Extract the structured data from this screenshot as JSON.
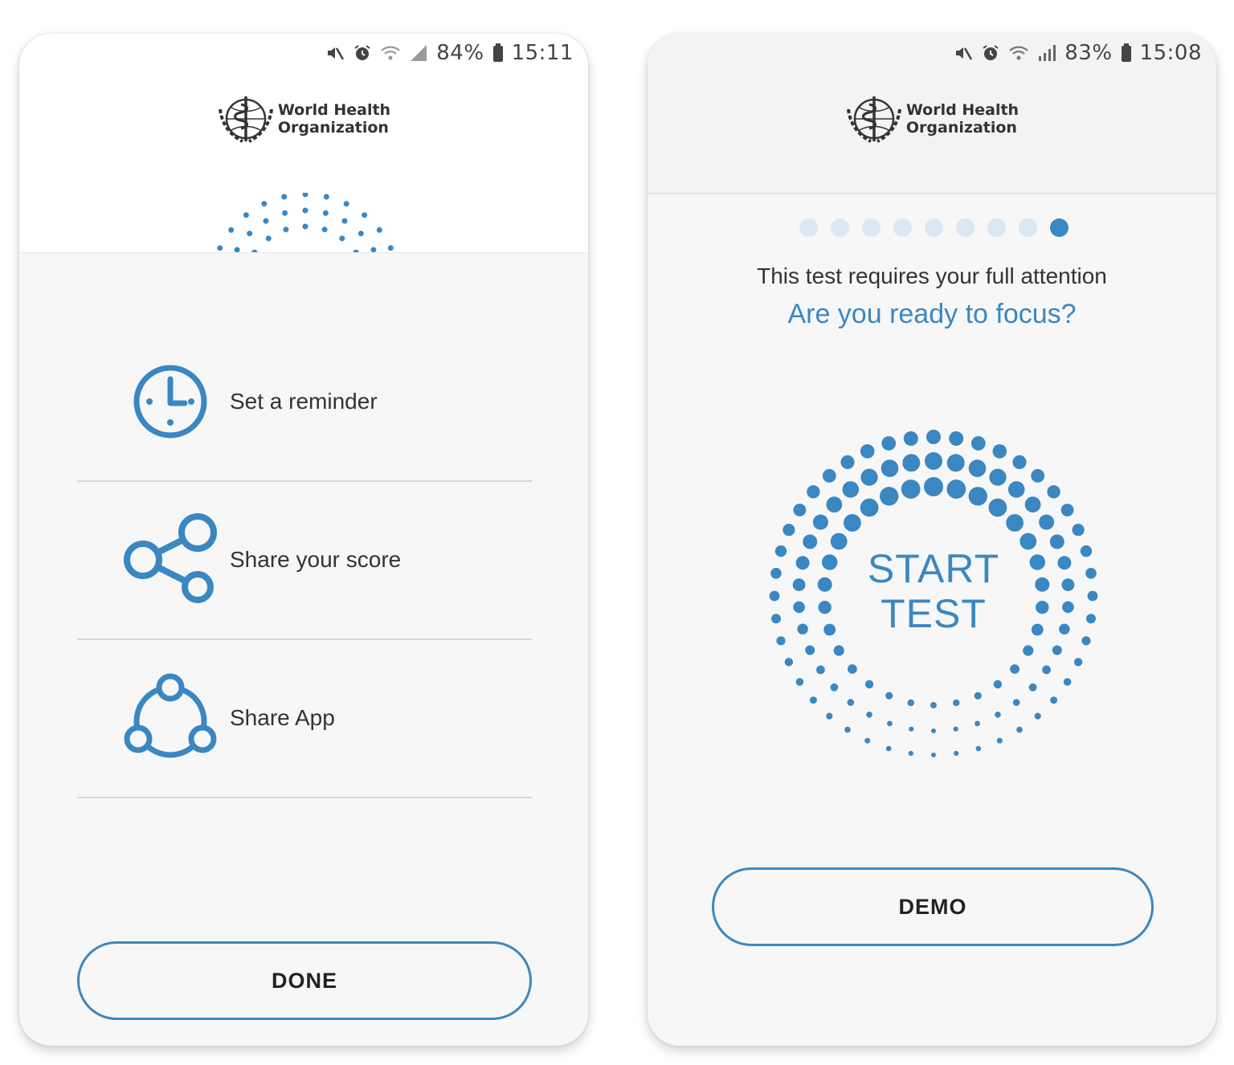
{
  "colors": {
    "accent": "#3a87c2",
    "dot_inactive": "#dbe7f2",
    "divider": "#d6d6d6"
  },
  "left_screen": {
    "status_bar": {
      "icons": [
        "mute-icon",
        "alarm-icon",
        "wifi-icon",
        "signal-icon",
        "battery-icon"
      ],
      "battery": "84%",
      "time": "15:11"
    },
    "logo": {
      "line1": "World Health",
      "line2": "Organization"
    },
    "menu": [
      {
        "label": "Set a reminder",
        "icon": "clock-icon"
      },
      {
        "label": "Share your score",
        "icon": "share-icon"
      },
      {
        "label": "Share App",
        "icon": "share-app-icon"
      }
    ],
    "done_label": "DONE"
  },
  "right_screen": {
    "status_bar": {
      "icons": [
        "mute-icon",
        "alarm-icon",
        "wifi-icon",
        "signal-icon",
        "battery-icon"
      ],
      "battery": "83%",
      "time": "15:08"
    },
    "logo": {
      "line1": "World Health",
      "line2": "Organization"
    },
    "pager": {
      "total": 9,
      "active": 9
    },
    "prompt": "This test requires your full attention",
    "question": "Are you ready to focus?",
    "start": {
      "line1": "START",
      "line2": "TEST"
    },
    "demo_label": "DEMO"
  }
}
